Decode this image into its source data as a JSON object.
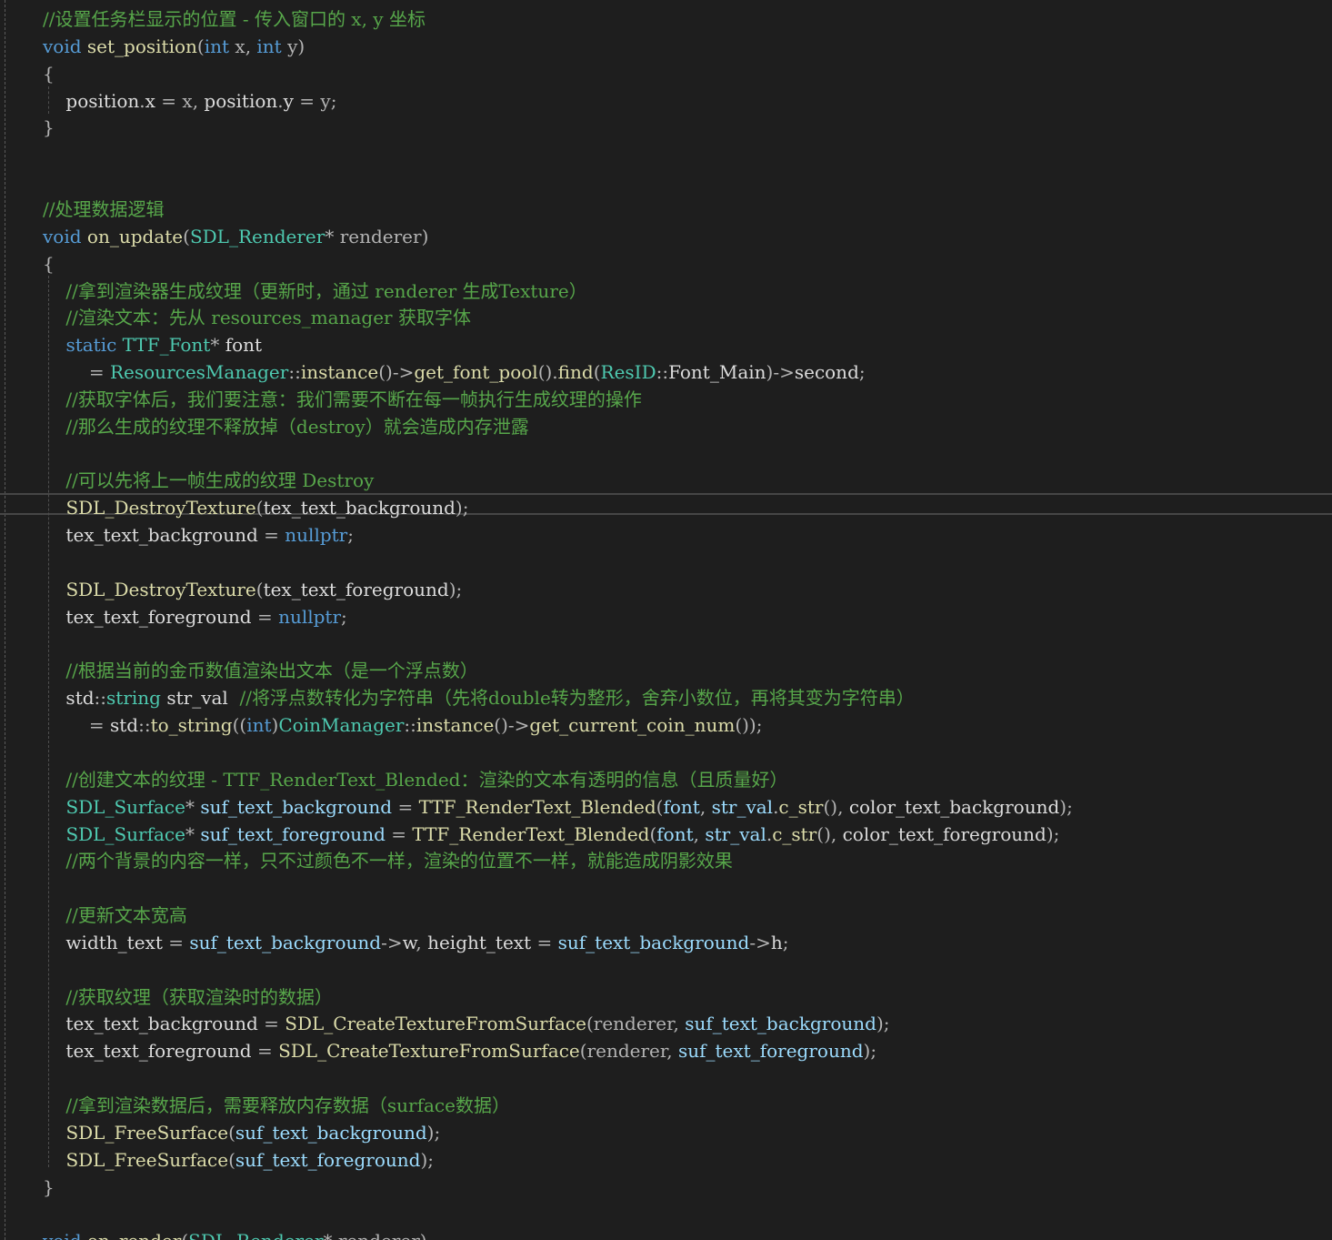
{
  "colors": {
    "background": "#1e1e1e",
    "comment": "#57a64a",
    "keyword": "#569cd6",
    "type": "#4ec9b0",
    "function": "#dcdcaa",
    "variable": "#9cdcfe",
    "parameter": "#b4b4b4",
    "text": "#dcdcdc"
  },
  "lines": [
    {
      "toks": [
        {
          "c": "c",
          "t": "//设置任务栏显示的位置 - 传入窗口的 x, y 坐标"
        }
      ]
    },
    {
      "toks": [
        {
          "c": "k",
          "t": "void"
        },
        {
          "c": "n",
          "t": " "
        },
        {
          "c": "f",
          "t": "set_position"
        },
        {
          "c": "o",
          "t": "("
        },
        {
          "c": "k",
          "t": "int"
        },
        {
          "c": "n",
          "t": " "
        },
        {
          "c": "p",
          "t": "x"
        },
        {
          "c": "o",
          "t": ", "
        },
        {
          "c": "k",
          "t": "int"
        },
        {
          "c": "n",
          "t": " "
        },
        {
          "c": "p",
          "t": "y"
        },
        {
          "c": "o",
          "t": ")"
        }
      ]
    },
    {
      "toks": [
        {
          "c": "o",
          "t": "{"
        }
      ]
    },
    {
      "toks": [
        {
          "c": "n",
          "t": "    position"
        },
        {
          "c": "o",
          "t": "."
        },
        {
          "c": "n",
          "t": "x "
        },
        {
          "c": "o",
          "t": "= "
        },
        {
          "c": "p",
          "t": "x"
        },
        {
          "c": "o",
          "t": ", "
        },
        {
          "c": "n",
          "t": "position"
        },
        {
          "c": "o",
          "t": "."
        },
        {
          "c": "n",
          "t": "y "
        },
        {
          "c": "o",
          "t": "= "
        },
        {
          "c": "p",
          "t": "y"
        },
        {
          "c": "o",
          "t": ";"
        }
      ]
    },
    {
      "toks": [
        {
          "c": "o",
          "t": "}"
        }
      ]
    },
    {
      "toks": []
    },
    {
      "toks": []
    },
    {
      "toks": [
        {
          "c": "c",
          "t": "//处理数据逻辑"
        }
      ]
    },
    {
      "toks": [
        {
          "c": "k",
          "t": "void"
        },
        {
          "c": "n",
          "t": " "
        },
        {
          "c": "f",
          "t": "on_update"
        },
        {
          "c": "o",
          "t": "("
        },
        {
          "c": "t",
          "t": "SDL_Renderer"
        },
        {
          "c": "o",
          "t": "* "
        },
        {
          "c": "p",
          "t": "renderer"
        },
        {
          "c": "o",
          "t": ")"
        }
      ]
    },
    {
      "toks": [
        {
          "c": "o",
          "t": "{"
        }
      ]
    },
    {
      "toks": [
        {
          "c": "c",
          "t": "    //拿到渲染器生成纹理（更新时，通过 renderer 生成Texture）"
        }
      ]
    },
    {
      "toks": [
        {
          "c": "c",
          "t": "    //渲染文本：先从 resources_manager 获取字体"
        }
      ]
    },
    {
      "toks": [
        {
          "c": "n",
          "t": "    "
        },
        {
          "c": "k",
          "t": "static"
        },
        {
          "c": "n",
          "t": " "
        },
        {
          "c": "t",
          "t": "TTF_Font"
        },
        {
          "c": "o",
          "t": "* "
        },
        {
          "c": "n",
          "t": "font"
        }
      ]
    },
    {
      "toks": [
        {
          "c": "n",
          "t": "        "
        },
        {
          "c": "o",
          "t": "= "
        },
        {
          "c": "t",
          "t": "ResourcesManager"
        },
        {
          "c": "o",
          "t": "::"
        },
        {
          "c": "f",
          "t": "instance"
        },
        {
          "c": "o",
          "t": "()->"
        },
        {
          "c": "f",
          "t": "get_font_pool"
        },
        {
          "c": "o",
          "t": "()."
        },
        {
          "c": "f",
          "t": "find"
        },
        {
          "c": "o",
          "t": "("
        },
        {
          "c": "t",
          "t": "ResID"
        },
        {
          "c": "o",
          "t": "::"
        },
        {
          "c": "n",
          "t": "Font_Main"
        },
        {
          "c": "o",
          "t": ")->"
        },
        {
          "c": "n",
          "t": "second"
        },
        {
          "c": "o",
          "t": ";"
        }
      ]
    },
    {
      "toks": [
        {
          "c": "c",
          "t": "    //获取字体后，我们要注意：我们需要不断在每一帧执行生成纹理的操作"
        }
      ]
    },
    {
      "toks": [
        {
          "c": "c",
          "t": "    //那么生成的纹理不释放掉（destroy）就会造成内存泄露"
        }
      ]
    },
    {
      "toks": []
    },
    {
      "toks": [
        {
          "c": "c",
          "t": "    //可以先将上一帧生成的纹理 Destroy"
        }
      ]
    },
    {
      "toks": [
        {
          "c": "n",
          "t": "    "
        },
        {
          "c": "f",
          "t": "SDL_DestroyTexture"
        },
        {
          "c": "o",
          "t": "("
        },
        {
          "c": "n",
          "t": "tex_text_background"
        },
        {
          "c": "o",
          "t": ");"
        }
      ]
    },
    {
      "toks": [
        {
          "c": "n",
          "t": "    tex_text_background "
        },
        {
          "c": "o",
          "t": "= "
        },
        {
          "c": "k",
          "t": "nullptr"
        },
        {
          "c": "o",
          "t": ";"
        }
      ]
    },
    {
      "toks": []
    },
    {
      "toks": [
        {
          "c": "n",
          "t": "    "
        },
        {
          "c": "f",
          "t": "SDL_DestroyTexture"
        },
        {
          "c": "o",
          "t": "("
        },
        {
          "c": "n",
          "t": "tex_text_foreground"
        },
        {
          "c": "o",
          "t": ");"
        }
      ]
    },
    {
      "toks": [
        {
          "c": "n",
          "t": "    tex_text_foreground "
        },
        {
          "c": "o",
          "t": "= "
        },
        {
          "c": "k",
          "t": "nullptr"
        },
        {
          "c": "o",
          "t": ";"
        }
      ]
    },
    {
      "toks": []
    },
    {
      "toks": [
        {
          "c": "c",
          "t": "    //根据当前的金币数值渲染出文本（是一个浮点数）"
        }
      ]
    },
    {
      "toks": [
        {
          "c": "n",
          "t": "    std"
        },
        {
          "c": "o",
          "t": "::"
        },
        {
          "c": "t",
          "t": "string"
        },
        {
          "c": "n",
          "t": " str_val  "
        },
        {
          "c": "c",
          "t": "//将浮点数转化为字符串（先将double转为整形，舍弃小数位，再将其变为字符串）"
        }
      ]
    },
    {
      "toks": [
        {
          "c": "n",
          "t": "        "
        },
        {
          "c": "o",
          "t": "= "
        },
        {
          "c": "n",
          "t": "std"
        },
        {
          "c": "o",
          "t": "::"
        },
        {
          "c": "f",
          "t": "to_string"
        },
        {
          "c": "o",
          "t": "(("
        },
        {
          "c": "k",
          "t": "int"
        },
        {
          "c": "o",
          "t": ")"
        },
        {
          "c": "t",
          "t": "CoinManager"
        },
        {
          "c": "o",
          "t": "::"
        },
        {
          "c": "f",
          "t": "instance"
        },
        {
          "c": "o",
          "t": "()->"
        },
        {
          "c": "f",
          "t": "get_current_coin_num"
        },
        {
          "c": "o",
          "t": "());"
        }
      ]
    },
    {
      "toks": []
    },
    {
      "toks": [
        {
          "c": "c",
          "t": "    //创建文本的纹理 - TTF_RenderText_Blended：渲染的文本有透明的信息（且质量好）"
        }
      ]
    },
    {
      "toks": [
        {
          "c": "n",
          "t": "    "
        },
        {
          "c": "t",
          "t": "SDL_Surface"
        },
        {
          "c": "o",
          "t": "* "
        },
        {
          "c": "v",
          "t": "suf_text_background"
        },
        {
          "c": "n",
          "t": " "
        },
        {
          "c": "o",
          "t": "= "
        },
        {
          "c": "f",
          "t": "TTF_RenderText_Blended"
        },
        {
          "c": "o",
          "t": "("
        },
        {
          "c": "v",
          "t": "font"
        },
        {
          "c": "o",
          "t": ", "
        },
        {
          "c": "v",
          "t": "str_val"
        },
        {
          "c": "o",
          "t": "."
        },
        {
          "c": "f",
          "t": "c_str"
        },
        {
          "c": "o",
          "t": "(), "
        },
        {
          "c": "n",
          "t": "color_text_background"
        },
        {
          "c": "o",
          "t": ");"
        }
      ]
    },
    {
      "toks": [
        {
          "c": "n",
          "t": "    "
        },
        {
          "c": "t",
          "t": "SDL_Surface"
        },
        {
          "c": "o",
          "t": "* "
        },
        {
          "c": "v",
          "t": "suf_text_foreground"
        },
        {
          "c": "n",
          "t": " "
        },
        {
          "c": "o",
          "t": "= "
        },
        {
          "c": "f",
          "t": "TTF_RenderText_Blended"
        },
        {
          "c": "o",
          "t": "("
        },
        {
          "c": "v",
          "t": "font"
        },
        {
          "c": "o",
          "t": ", "
        },
        {
          "c": "v",
          "t": "str_val"
        },
        {
          "c": "o",
          "t": "."
        },
        {
          "c": "f",
          "t": "c_str"
        },
        {
          "c": "o",
          "t": "(), "
        },
        {
          "c": "n",
          "t": "color_text_foreground"
        },
        {
          "c": "o",
          "t": ");"
        }
      ]
    },
    {
      "toks": [
        {
          "c": "c",
          "t": "    //两个背景的内容一样，只不过颜色不一样，渲染的位置不一样，就能造成阴影效果"
        }
      ]
    },
    {
      "toks": []
    },
    {
      "toks": [
        {
          "c": "c",
          "t": "    //更新文本宽高"
        }
      ]
    },
    {
      "toks": [
        {
          "c": "n",
          "t": "    width_text "
        },
        {
          "c": "o",
          "t": "= "
        },
        {
          "c": "v",
          "t": "suf_text_background"
        },
        {
          "c": "o",
          "t": "->"
        },
        {
          "c": "n",
          "t": "w"
        },
        {
          "c": "o",
          "t": ", "
        },
        {
          "c": "n",
          "t": "height_text "
        },
        {
          "c": "o",
          "t": "= "
        },
        {
          "c": "v",
          "t": "suf_text_background"
        },
        {
          "c": "o",
          "t": "->"
        },
        {
          "c": "n",
          "t": "h"
        },
        {
          "c": "o",
          "t": ";"
        }
      ]
    },
    {
      "toks": []
    },
    {
      "toks": [
        {
          "c": "c",
          "t": "    //获取纹理（获取渲染时的数据）"
        }
      ]
    },
    {
      "toks": [
        {
          "c": "n",
          "t": "    tex_text_background "
        },
        {
          "c": "o",
          "t": "= "
        },
        {
          "c": "f",
          "t": "SDL_CreateTextureFromSurface"
        },
        {
          "c": "o",
          "t": "("
        },
        {
          "c": "p",
          "t": "renderer"
        },
        {
          "c": "o",
          "t": ", "
        },
        {
          "c": "v",
          "t": "suf_text_background"
        },
        {
          "c": "o",
          "t": ");"
        }
      ]
    },
    {
      "toks": [
        {
          "c": "n",
          "t": "    tex_text_foreground "
        },
        {
          "c": "o",
          "t": "= "
        },
        {
          "c": "f",
          "t": "SDL_CreateTextureFromSurface"
        },
        {
          "c": "o",
          "t": "("
        },
        {
          "c": "p",
          "t": "renderer"
        },
        {
          "c": "o",
          "t": ", "
        },
        {
          "c": "v",
          "t": "suf_text_foreground"
        },
        {
          "c": "o",
          "t": ");"
        }
      ]
    },
    {
      "toks": []
    },
    {
      "toks": [
        {
          "c": "c",
          "t": "    //拿到渲染数据后，需要释放内存数据（surface数据）"
        }
      ]
    },
    {
      "toks": [
        {
          "c": "n",
          "t": "    "
        },
        {
          "c": "f",
          "t": "SDL_FreeSurface"
        },
        {
          "c": "o",
          "t": "("
        },
        {
          "c": "v",
          "t": "suf_text_background"
        },
        {
          "c": "o",
          "t": ");"
        }
      ]
    },
    {
      "toks": [
        {
          "c": "n",
          "t": "    "
        },
        {
          "c": "f",
          "t": "SDL_FreeSurface"
        },
        {
          "c": "o",
          "t": "("
        },
        {
          "c": "v",
          "t": "suf_text_foreground"
        },
        {
          "c": "o",
          "t": ");"
        }
      ]
    },
    {
      "toks": [
        {
          "c": "o",
          "t": "}"
        }
      ]
    },
    {
      "toks": []
    },
    {
      "toks": [
        {
          "c": "k",
          "t": "void"
        },
        {
          "c": "n",
          "t": " "
        },
        {
          "c": "f",
          "t": "on_render"
        },
        {
          "c": "o",
          "t": "("
        },
        {
          "c": "t",
          "t": "SDL_Renderer"
        },
        {
          "c": "o",
          "t": "* "
        },
        {
          "c": "p",
          "t": "renderer"
        },
        {
          "c": "o",
          "t": ")"
        }
      ]
    }
  ]
}
